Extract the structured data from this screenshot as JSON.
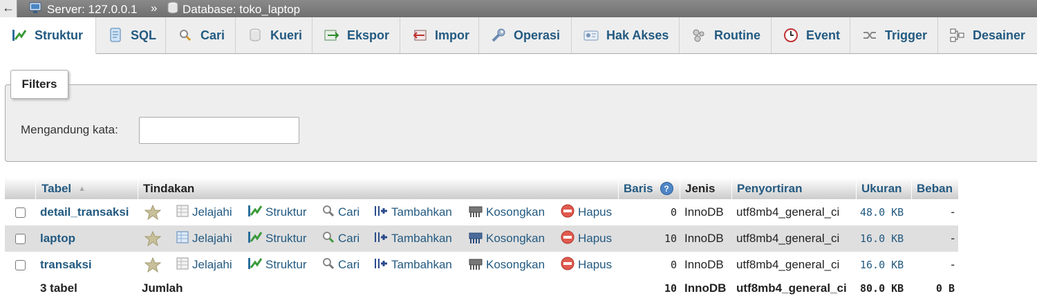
{
  "topbar": {
    "back": "←",
    "server": "Server: 127.0.0.1",
    "separator": "»",
    "database": "Database: toko_laptop"
  },
  "tabs": [
    {
      "label": "Struktur",
      "icon": "structure-icon"
    },
    {
      "label": "SQL",
      "icon": "sql-icon"
    },
    {
      "label": "Cari",
      "icon": "search-icon"
    },
    {
      "label": "Kueri",
      "icon": "query-icon"
    },
    {
      "label": "Ekspor",
      "icon": "export-icon"
    },
    {
      "label": "Impor",
      "icon": "import-icon"
    },
    {
      "label": "Operasi",
      "icon": "wrench-icon"
    },
    {
      "label": "Hak Akses",
      "icon": "privileges-icon"
    },
    {
      "label": "Routine",
      "icon": "routine-icon"
    },
    {
      "label": "Event",
      "icon": "clock-icon"
    },
    {
      "label": "Trigger",
      "icon": "trigger-icon"
    },
    {
      "label": "Desainer",
      "icon": "designer-icon"
    }
  ],
  "filters": {
    "legend": "Filters",
    "label": "Mengandung kata:",
    "value": ""
  },
  "table": {
    "headers": {
      "tabel": "Tabel",
      "sort": "▲",
      "tindakan": "Tindakan",
      "baris": "Baris",
      "help": "?",
      "jenis": "Jenis",
      "penyortiran": "Penyortiran",
      "ukuran": "Ukuran",
      "beban": "Beban"
    },
    "actions": {
      "jelajahi": "Jelajahi",
      "struktur": "Struktur",
      "cari": "Cari",
      "tambahkan": "Tambahkan",
      "kosongkan": "Kosongkan",
      "hapus": "Hapus"
    },
    "rows": [
      {
        "name": "detail_transaksi",
        "rows": "0",
        "engine": "InnoDB",
        "collation": "utf8mb4_general_ci",
        "size": "48.0 KB",
        "overhead": "-"
      },
      {
        "name": "laptop",
        "rows": "10",
        "engine": "InnoDB",
        "collation": "utf8mb4_general_ci",
        "size": "16.0 KB",
        "overhead": "-"
      },
      {
        "name": "transaksi",
        "rows": "0",
        "engine": "InnoDB",
        "collation": "utf8mb4_general_ci",
        "size": "16.0 KB",
        "overhead": "-"
      }
    ],
    "footer": {
      "count": "3 tabel",
      "label": "Jumlah",
      "rows": "10",
      "engine": "InnoDB",
      "collation": "utf8mb4_general_ci",
      "size": "80.0 KB",
      "overhead": "0 B"
    }
  },
  "colors": {
    "link": "#235a81",
    "delete": "#d9534f",
    "star": "#b9b08a"
  }
}
